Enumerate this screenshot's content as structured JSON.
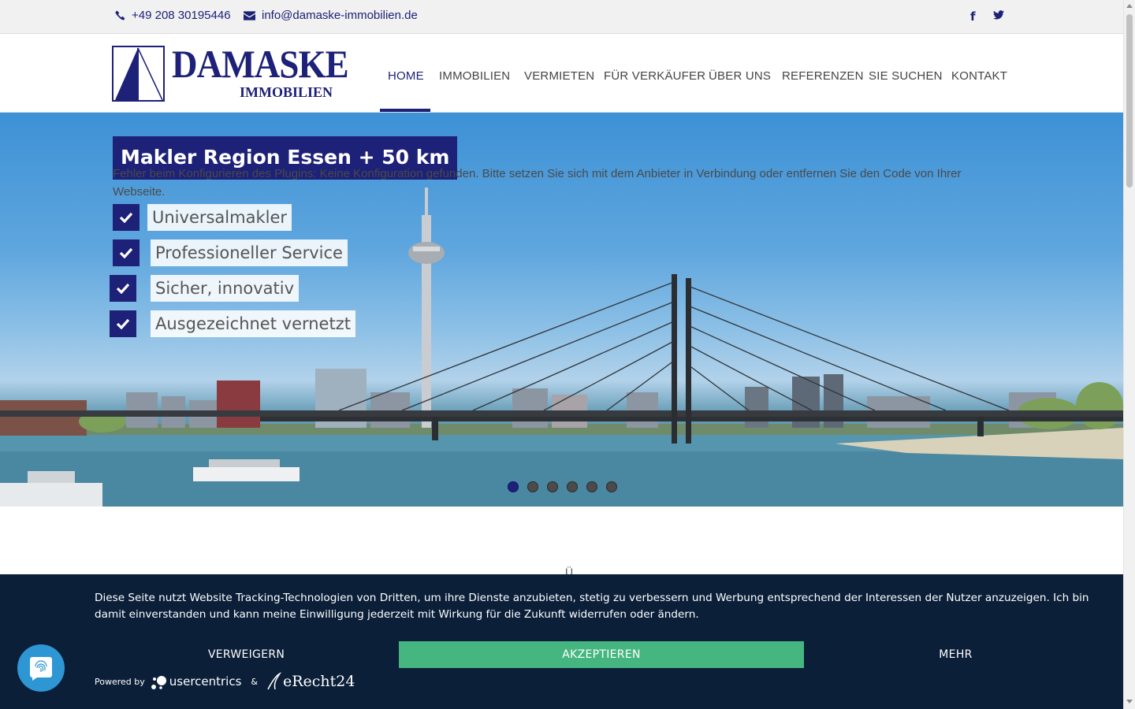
{
  "topbar": {
    "phone": "+49 208 30195446",
    "email": "info@damaske-immobilien.de",
    "social": [
      {
        "name": "facebook",
        "glyph": "f"
      },
      {
        "name": "twitter",
        "glyph": "t"
      }
    ]
  },
  "logo": {
    "line1": "DAMASKE",
    "line2": "IMMOBILIEN"
  },
  "nav": {
    "items": [
      {
        "label": "HOME",
        "active": true
      },
      {
        "label": "IMMOBILIEN"
      },
      {
        "label": "VERMIETEN"
      },
      {
        "label": "FÜR VERKÄUFER"
      },
      {
        "label": "ÜBER UNS"
      },
      {
        "label": "REFERENZEN"
      },
      {
        "label": "SIE SUCHEN"
      },
      {
        "label": "KONTAKT"
      }
    ]
  },
  "hero": {
    "title": "Makler Region Essen + 50 km",
    "plugin_error": "Fehler beim Konfigurieren des Plugins: Keine Konfiguration gefunden. Bitte setzen Sie sich mit dem Anbieter in Verbindung oder entfernen Sie den Code von Ihrer Webseite.",
    "features": [
      "Universalmakler",
      "Professioneller Service",
      "Sicher, innovativ",
      "Ausgezeichnet vernetzt"
    ],
    "slide_count": 6,
    "active_slide": 1
  },
  "section_peek": "Ü",
  "cookie": {
    "text": "Diese Seite nutzt Website Tracking-Technologien von Dritten, um ihre Dienste anzubieten, stetig zu verbessern und Werbung entsprechend der Interessen der Nutzer anzuzeigen. Ich bin damit einverstanden und kann meine Einwilligung jederzeit mit Wirkung für die Zukunft widerrufen oder ändern.",
    "deny": "VERWEIGERN",
    "accept": "AKZEPTIEREN",
    "more": "MEHR",
    "powered_by": "Powered by",
    "usercentrics": "usercentrics",
    "amp": "&",
    "erecht": "eRecht24"
  },
  "colors": {
    "brand": "#1d2177",
    "accept": "#45b680",
    "banner": "#0b1f39",
    "fingerprint_button": "#2f96d4"
  }
}
